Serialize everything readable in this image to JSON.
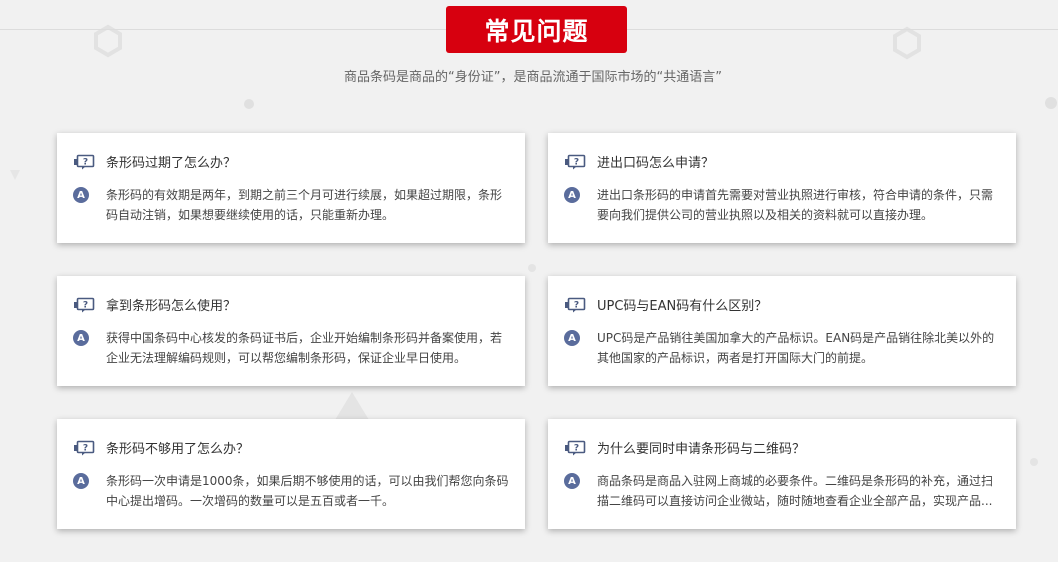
{
  "header": {
    "title": "常见问题",
    "subtitle": "商品条码是商品的“身份证”，是商品流通于国际市场的“共通语言”"
  },
  "icons": {
    "question": "question-chat-icon",
    "answer": "answer-a-icon"
  },
  "colors": {
    "accent": "#d7000f",
    "answer_badge": "#5a6c9c"
  },
  "faq": [
    {
      "question": "条形码过期了怎么办？",
      "answer_badge": "A",
      "answer": "条形码的有效期是两年，到期之前三个月可进行续展，如果超过期限，条形码自动注销，如果想要继续使用的话，只能重新办理。"
    },
    {
      "question": "进出口码怎么申请？",
      "answer_badge": "A",
      "answer": "进出口条形码的申请首先需要对营业执照进行审核，符合申请的条件，只需要向我们提供公司的营业执照以及相关的资料就可以直接办理。"
    },
    {
      "question": "拿到条形码怎么使用？",
      "answer_badge": "A",
      "answer": "获得中国条码中心核发的条码证书后，企业开始编制条形码并备案使用，若企业无法理解编码规则，可以帮您编制条形码，保证企业早日使用。"
    },
    {
      "question": "UPC码与EAN码有什么区别？",
      "answer_badge": "A",
      "answer": "UPC码是产品销往美国加拿大的产品标识。EAN码是产品销往除北美以外的其他国家的产品标识，两者是打开国际大门的前提。"
    },
    {
      "question": "条形码不够用了怎么办？",
      "answer_badge": "A",
      "answer": "条形码一次申请是1000条，如果后期不够使用的话，可以由我们帮您向条码中心提出增码。一次增码的数量可以是五百或者一千。"
    },
    {
      "question": "为什么要同时申请条形码与二维码？",
      "answer_badge": "A",
      "answer": "商品条码是商品入驻网上商城的必要条件。二维码是条形码的补充，通过扫描二维码可以直接访问企业微站，随时随地查看企业全部产品，实现产品..."
    }
  ]
}
